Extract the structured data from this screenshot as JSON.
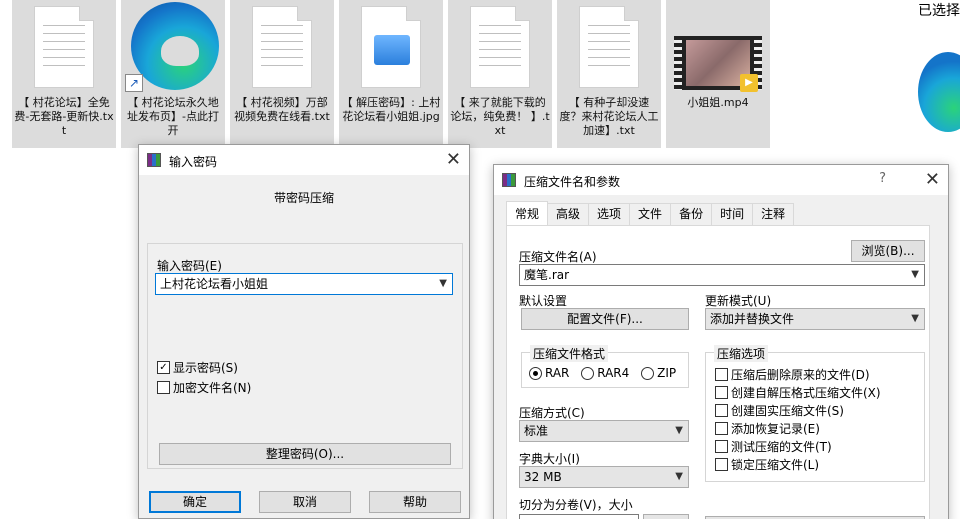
{
  "desktop": {
    "files": [
      {
        "name": "【 村花论坛】全免费-无套路-更新快.txt",
        "icon": "text-file-icon"
      },
      {
        "name": "【 村花论坛永久地址发布页】-点此打开",
        "icon": "edge-shortcut-icon"
      },
      {
        "name": "【 村花视频】万部视频免费在线看.txt",
        "icon": "text-file-icon"
      },
      {
        "name": "【 解压密码】: 上村花论坛看小姐姐.jpg",
        "icon": "image-file-icon"
      },
      {
        "name": "【 来了就能下载的论坛，纯免费！ 】.txt",
        "icon": "text-file-icon"
      },
      {
        "name": "【 有种子却没速度？来村花论坛人工加速】.txt",
        "icon": "text-file-icon"
      },
      {
        "name": "小姐姐.mp4",
        "icon": "video-file-icon"
      }
    ],
    "side_text": "已选择"
  },
  "password_dialog": {
    "title": "输入密码",
    "heading": "带密码压缩",
    "password_label": "输入密码(E)",
    "password_value": "上村花论坛看小姐姐",
    "show_password_label": "显示密码(S)",
    "show_password_checked": true,
    "encrypt_names_label": "加密文件名(N)",
    "encrypt_names_checked": false,
    "organize_button": "整理密码(O)...",
    "ok_button": "确定",
    "cancel_button": "取消",
    "help_button": "帮助"
  },
  "archive_dialog": {
    "title": "压缩文件名和参数",
    "help_symbol": "?",
    "tabs": [
      "常规",
      "高级",
      "选项",
      "文件",
      "备份",
      "时间",
      "注释"
    ],
    "active_tab": "常规",
    "archive_name_label": "压缩文件名(A)",
    "browse_button": "浏览(B)...",
    "archive_name_value": "魔笔.rar",
    "default_settings_label": "默认设置",
    "profiles_button": "配置文件(F)...",
    "update_mode_label": "更新模式(U)",
    "update_mode_value": "添加并替换文件",
    "format_group": "压缩文件格式",
    "formats": [
      "RAR",
      "RAR4",
      "ZIP"
    ],
    "selected_format": "RAR",
    "method_label": "压缩方式(C)",
    "method_value": "标准",
    "dict_label": "字典大小(I)",
    "dict_value": "32 MB",
    "split_label": "切分为分卷(V)，大小",
    "options_group": "压缩选项",
    "options": [
      "压缩后删除原来的文件(D)",
      "创建自解压格式压缩文件(X)",
      "创建固实压缩文件(S)",
      "添加恢复记录(E)",
      "测试压缩的文件(T)",
      "锁定压缩文件(L)"
    ]
  }
}
